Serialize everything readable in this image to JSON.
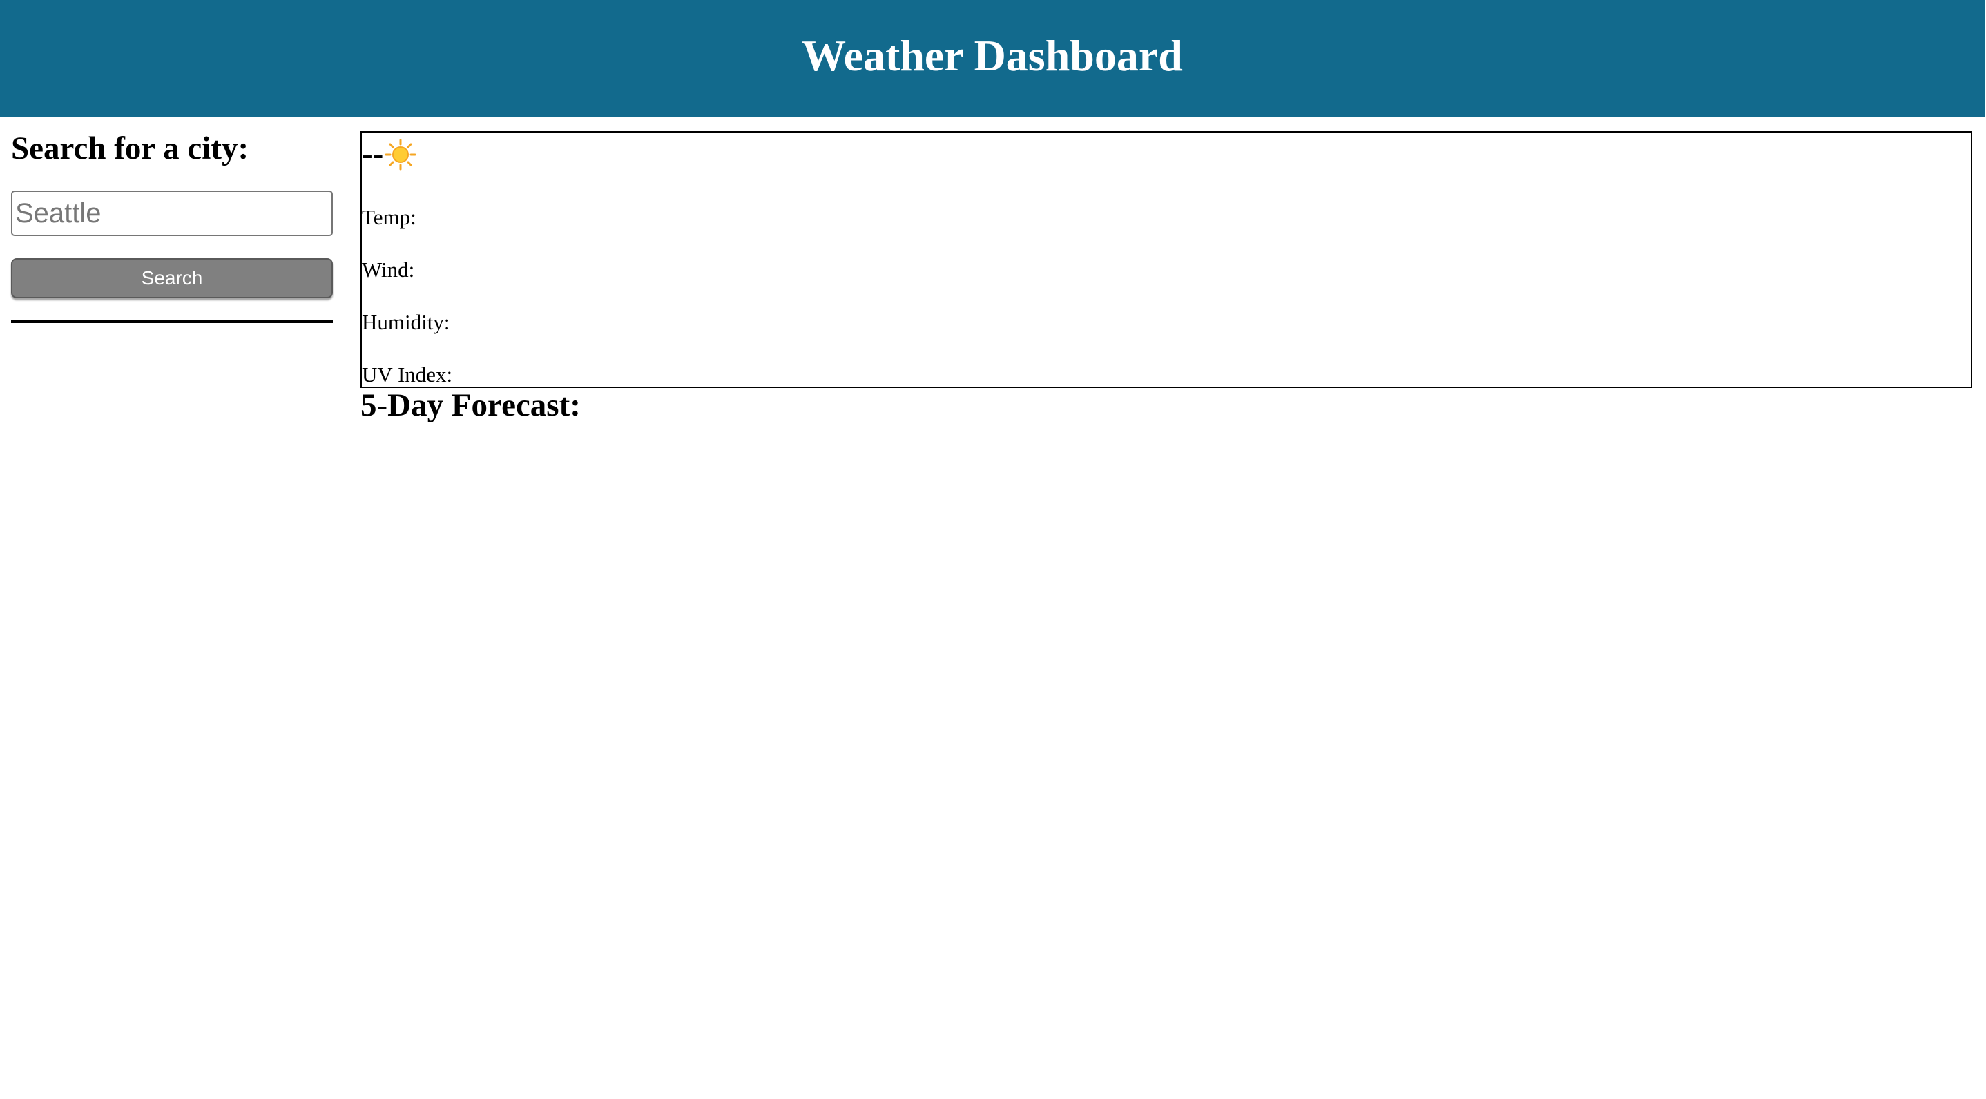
{
  "header": {
    "title": "Weather Dashboard",
    "background_color": "#126a8d"
  },
  "sidebar": {
    "heading": "Search for a city:",
    "search": {
      "placeholder": "Seattle",
      "value": ""
    },
    "search_button_label": "Search",
    "button_color": "#808080"
  },
  "current": {
    "city": "--",
    "icon": "sun-icon",
    "temp_label": "Temp:",
    "wind_label": "Wind:",
    "humidity_label": "Humidity:",
    "uv_label": "UV Index:"
  },
  "forecast": {
    "heading": "5-Day Forecast:"
  }
}
